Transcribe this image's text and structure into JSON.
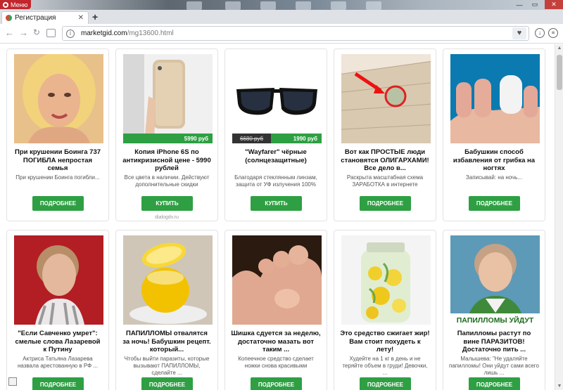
{
  "window": {
    "menu_label": "Меню"
  },
  "tab": {
    "title": "Регистрация"
  },
  "address": {
    "host": "marketgid.com",
    "path": "/mg13600.html"
  },
  "cards": [
    {
      "title": "При крушении Боинга 737 ПОГИБЛА непростая семья",
      "desc": "При крушении Боинга погибли...",
      "button": "ПОДРОБНЕЕ"
    },
    {
      "title": "Копия iPhone 6S по антикризисной цене - 5990 рублей",
      "desc": "Все цвета в наличии. Действуют дополнительные скидки",
      "button": "КУПИТЬ",
      "price": "5990 руб",
      "source": "dialogdv.ru"
    },
    {
      "title": "\"Wayfarer\" чёрные (солнцезащитные)",
      "desc": "Благодаря стеклянным линзам, защита от УФ излучения 100%",
      "button": "КУПИТЬ",
      "price": "1990 руб",
      "old_price": "6680 руб"
    },
    {
      "title": "Вот как ПРОСТЫЕ люди становятся ОЛИГАРХАМИ! Все дело в...",
      "desc": "Раскрыта масштабная схема ЗАРАБОТКА в интернете",
      "button": "ПОДРОБНЕЕ"
    },
    {
      "title": "Бабушкин способ избавления от грибка на ногтях",
      "desc": "Записывай: на ночь...",
      "button": "ПОДРОБНЕЕ"
    },
    {
      "title": "\"Если Савченко умрет\": смелые слова Лазаревой к Путину",
      "desc": "Актриса Татьяна Лазарева назвала арестованную в РФ ...",
      "button": "ПОДРОБНЕЕ"
    },
    {
      "title": "ПАПИЛЛОМЫ отвалятся за ночь! Бабушкин рецепт. который...",
      "desc": "Чтобы выйти паразиты, которые вызывают ПАПИЛЛОМЫ, сделайте ...",
      "button": "ПОДРОБНЕЕ"
    },
    {
      "title": "Шишка сдуется за неделю, достаточно мазать вот таким ...",
      "desc": "Копеечное средство сделает ножки снова красивыми",
      "button": "ПОДРОБНЕЕ"
    },
    {
      "title": "Это средство сжигает жир! Вам стоит похудеть к лету!",
      "desc": "Худейте на 1 кг в день и не теряйте объем в груди! Девочки, ...",
      "button": "ПОДРОБНЕЕ"
    },
    {
      "title": "Папилломы растут по вине ПАРАЗИТОВ! Достаточно пить ...",
      "desc": "Малышева: \"Не удаляйте папилломы! Они уйдут сами всего лишь ...",
      "button": "ПОДРОБНЕЕ",
      "banner": "ПАПИЛЛОМЫ УЙДУТ"
    }
  ],
  "colors": {
    "accent": "#2ea043",
    "browser_red": "#c1272d"
  }
}
